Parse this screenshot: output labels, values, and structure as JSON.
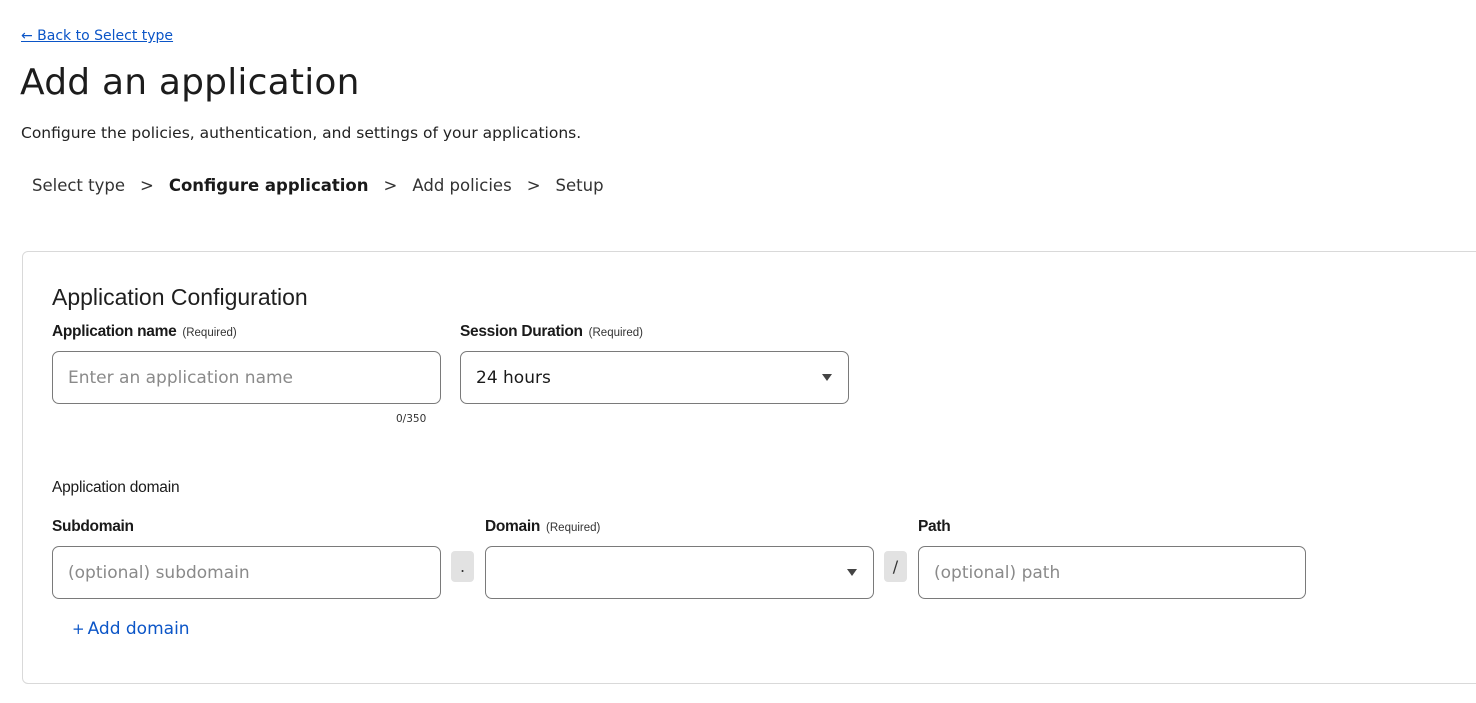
{
  "nav": {
    "back_link": "← Back to Select type"
  },
  "header": {
    "title": "Add an application",
    "subtitle": "Configure the policies, authentication, and settings of your applications."
  },
  "breadcrumb": {
    "steps": [
      "Select type",
      "Configure application",
      "Add policies",
      "Setup"
    ],
    "active_index": 1,
    "separator": ">"
  },
  "config": {
    "title": "Application Configuration",
    "app_name": {
      "label": "Application name",
      "required": "(Required)",
      "value": "",
      "placeholder": "Enter an application name",
      "counter": "0/350"
    },
    "session_duration": {
      "label": "Session Duration",
      "required": "(Required)",
      "value": "24 hours"
    },
    "domain_section_label": "Application domain",
    "subdomain": {
      "label": "Subdomain",
      "value": "",
      "placeholder": "(optional) subdomain"
    },
    "dot_separator": ".",
    "domain": {
      "label": "Domain",
      "required": "(Required)",
      "value": ""
    },
    "slash_separator": "/",
    "path": {
      "label": "Path",
      "value": "",
      "placeholder": "(optional) path"
    },
    "add_domain": {
      "icon": "+",
      "label": "Add domain"
    }
  },
  "colors": {
    "link": "#0b55c7",
    "border": "#7a7a7a",
    "card_border": "#d9d9d9",
    "chip_bg": "#e2e2e2"
  }
}
